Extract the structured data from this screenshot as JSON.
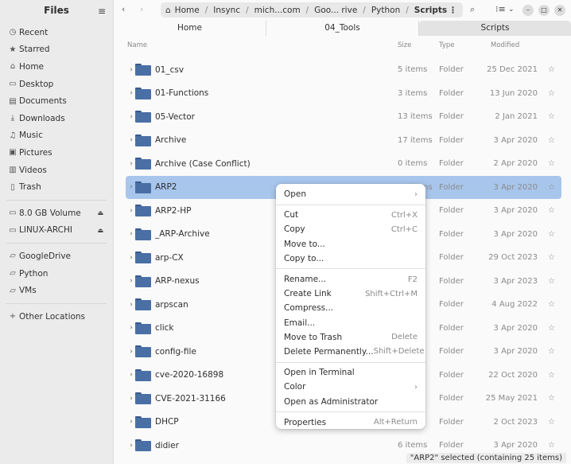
{
  "sidebar": {
    "title": "Files",
    "menu_icon": "hamburger-icon",
    "places": [
      {
        "label": "Recent",
        "icon": "clock-icon"
      },
      {
        "label": "Starred",
        "icon": "star-icon"
      },
      {
        "label": "Home",
        "icon": "home-icon"
      },
      {
        "label": "Desktop",
        "icon": "desktop-icon"
      },
      {
        "label": "Documents",
        "icon": "document-icon"
      },
      {
        "label": "Downloads",
        "icon": "download-icon"
      },
      {
        "label": "Music",
        "icon": "music-icon"
      },
      {
        "label": "Pictures",
        "icon": "picture-icon"
      },
      {
        "label": "Videos",
        "icon": "video-icon"
      },
      {
        "label": "Trash",
        "icon": "trash-icon"
      }
    ],
    "devices": [
      {
        "label": "8.0 GB Volume",
        "icon": "drive-icon"
      },
      {
        "label": "LINUX-ARCHI",
        "icon": "drive-icon"
      }
    ],
    "bookmarks": [
      {
        "label": "GoogleDrive",
        "icon": "folder-icon"
      },
      {
        "label": "Python",
        "icon": "folder-icon"
      },
      {
        "label": "VMs",
        "icon": "folder-icon"
      }
    ],
    "other": {
      "label": "Other Locations",
      "icon": "plus-icon"
    }
  },
  "path": {
    "segments": [
      "Home",
      "Insync",
      "mich...com",
      "Goo... rive",
      "Python",
      "Scripts"
    ],
    "more": "⋮"
  },
  "tabs": [
    {
      "label": "Home"
    },
    {
      "label": "04_Tools"
    },
    {
      "label": "Scripts"
    }
  ],
  "columns": {
    "name": "Name",
    "size": "Size",
    "type": "Type",
    "modified": "Modified"
  },
  "files": [
    {
      "name": "01_csv",
      "size": "5 items",
      "type": "Folder",
      "modified": "25 Dec 2021"
    },
    {
      "name": "01-Functions",
      "size": "3 items",
      "type": "Folder",
      "modified": "13 Jun 2020"
    },
    {
      "name": "05-Vector",
      "size": "13 items",
      "type": "Folder",
      "modified": "2 Jan 2021"
    },
    {
      "name": "Archive",
      "size": "17 items",
      "type": "Folder",
      "modified": "3 Apr 2020"
    },
    {
      "name": "Archive (Case Conflict)",
      "size": "0 items",
      "type": "Folder",
      "modified": "2 Apr 2020"
    },
    {
      "name": "ARP2",
      "size": "25 items",
      "type": "Folder",
      "modified": "3 Apr 2020"
    },
    {
      "name": "ARP2-HP",
      "size": "",
      "type": "Folder",
      "modified": "3 Apr 2020"
    },
    {
      "name": "_ARP-Archive",
      "size": "s",
      "type": "Folder",
      "modified": "3 Apr 2020"
    },
    {
      "name": "arp-CX",
      "size": "s",
      "type": "Folder",
      "modified": "29 Oct 2023"
    },
    {
      "name": "ARP-nexus",
      "size": "s",
      "type": "Folder",
      "modified": "3 Apr 2023"
    },
    {
      "name": "arpscan",
      "size": "",
      "type": "Folder",
      "modified": "4 Aug 2022"
    },
    {
      "name": "click",
      "size": "",
      "type": "Folder",
      "modified": "3 Apr 2020"
    },
    {
      "name": "config-file",
      "size": "s",
      "type": "Folder",
      "modified": "3 Apr 2020"
    },
    {
      "name": "cve-2020-16898",
      "size": "",
      "type": "Folder",
      "modified": "22 Oct 2020"
    },
    {
      "name": "CVE-2021-31166",
      "size": "",
      "type": "Folder",
      "modified": "25 May 2021"
    },
    {
      "name": "DHCP",
      "size": "",
      "type": "Folder",
      "modified": "2 Oct 2023"
    },
    {
      "name": "didier",
      "size": "6 items",
      "type": "Folder",
      "modified": "3 Apr 2020"
    }
  ],
  "context_menu": [
    {
      "label": "Open",
      "shortcut": "›"
    },
    {
      "sep": true
    },
    {
      "label": "Cut",
      "shortcut": "Ctrl+X"
    },
    {
      "label": "Copy",
      "shortcut": "Ctrl+C"
    },
    {
      "label": "Move to...",
      "shortcut": ""
    },
    {
      "label": "Copy to...",
      "shortcut": ""
    },
    {
      "sep": true
    },
    {
      "label": "Rename...",
      "shortcut": "F2"
    },
    {
      "label": "Create Link",
      "shortcut": "Shift+Ctrl+M"
    },
    {
      "label": "Compress...",
      "shortcut": ""
    },
    {
      "label": "Email...",
      "shortcut": ""
    },
    {
      "label": "Move to Trash",
      "shortcut": "Delete"
    },
    {
      "label": "Delete Permanently...",
      "shortcut": "Shift+Delete"
    },
    {
      "sep": true
    },
    {
      "label": "Open in Terminal",
      "shortcut": ""
    },
    {
      "label": "Color",
      "shortcut": "›"
    },
    {
      "label": "Open as Administrator",
      "shortcut": ""
    },
    {
      "sep": true
    },
    {
      "label": "Properties",
      "shortcut": "Alt+Return"
    }
  ],
  "status": "\"ARP2\" selected (containing 25 items)",
  "colors": {
    "selection": "#a8c6ec",
    "folder": "#4a6fa5"
  }
}
